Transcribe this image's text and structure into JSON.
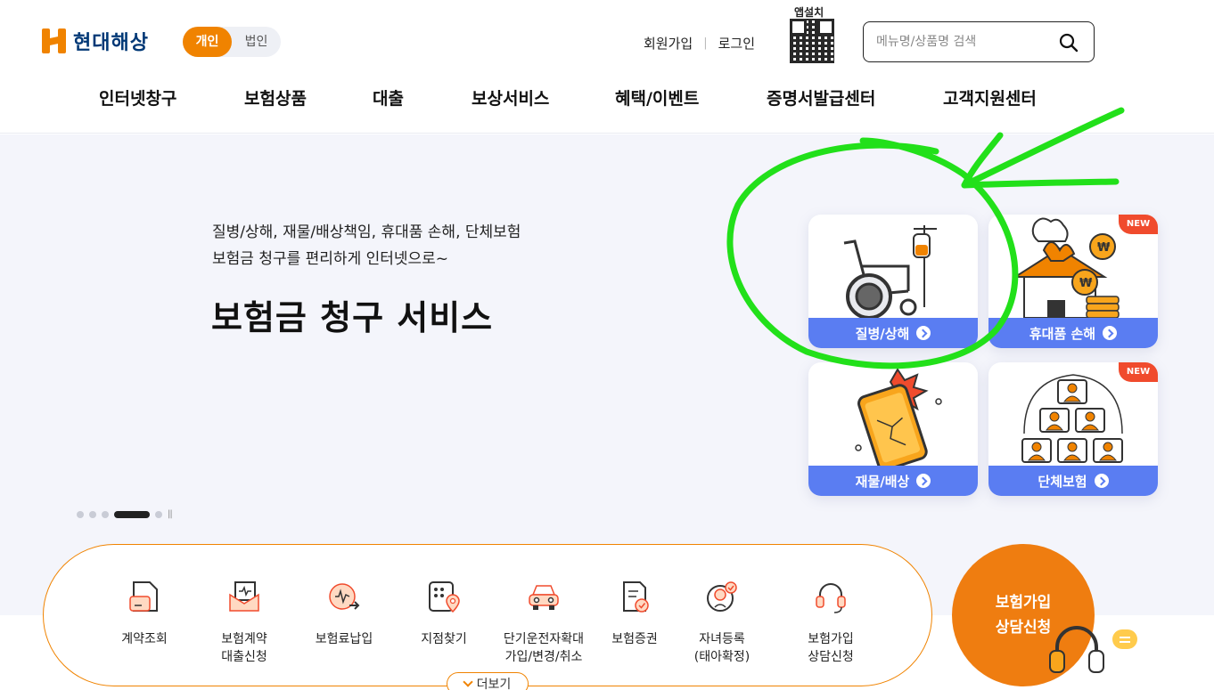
{
  "header": {
    "logo_text": "현대해상",
    "segment": {
      "personal": "개인",
      "corporate": "법인",
      "selected": "개인"
    },
    "util": {
      "join": "회원가입",
      "login": "로그인"
    },
    "qr_label": "앱설치",
    "search": {
      "placeholder": "메뉴명/상품명 검색",
      "value": ""
    }
  },
  "gnb": [
    "인터넷창구",
    "보험상품",
    "대출",
    "보상서비스",
    "혜택/이벤트",
    "증명서발급센터",
    "고객지원센터"
  ],
  "hero": {
    "subtitle_line1": "질병/상해, 재물/배상책임, 휴대품 손해, 단체보험",
    "subtitle_line2": "보험금 청구를 편리하게 인터넷으로~",
    "title": "보험금 청구 서비스",
    "cards": [
      {
        "label": "질병/상해",
        "new": false
      },
      {
        "label": "휴대품 손해",
        "new": true,
        "badge": "NEW"
      },
      {
        "label": "재물/배상",
        "new": false
      },
      {
        "label": "단체보험",
        "new": true,
        "badge": "NEW"
      }
    ]
  },
  "quick_menu": [
    {
      "label": "계약조회",
      "icon": "contract-search-icon"
    },
    {
      "label": "보험계약\n대출신청",
      "icon": "loan-envelope-icon"
    },
    {
      "label": "보험료납입",
      "icon": "premium-payment-icon"
    },
    {
      "label": "지점찾기",
      "icon": "branch-locator-icon"
    },
    {
      "label": "단기운전자확대\n가입/변경/취소",
      "icon": "car-icon"
    },
    {
      "label": "보험증권",
      "icon": "certificate-icon"
    },
    {
      "label": "자녀등록\n(태아확정)",
      "icon": "child-register-icon"
    },
    {
      "label": "보험가입\n상담신청",
      "icon": "headset-icon"
    }
  ],
  "more_label": "더보기",
  "consult": {
    "line1": "보험가입",
    "line2": "상담신청"
  },
  "colors": {
    "brand_orange": "#f08300",
    "card_blue": "#5a7df2",
    "navy": "#003876",
    "annotation_green": "#22e01a"
  }
}
